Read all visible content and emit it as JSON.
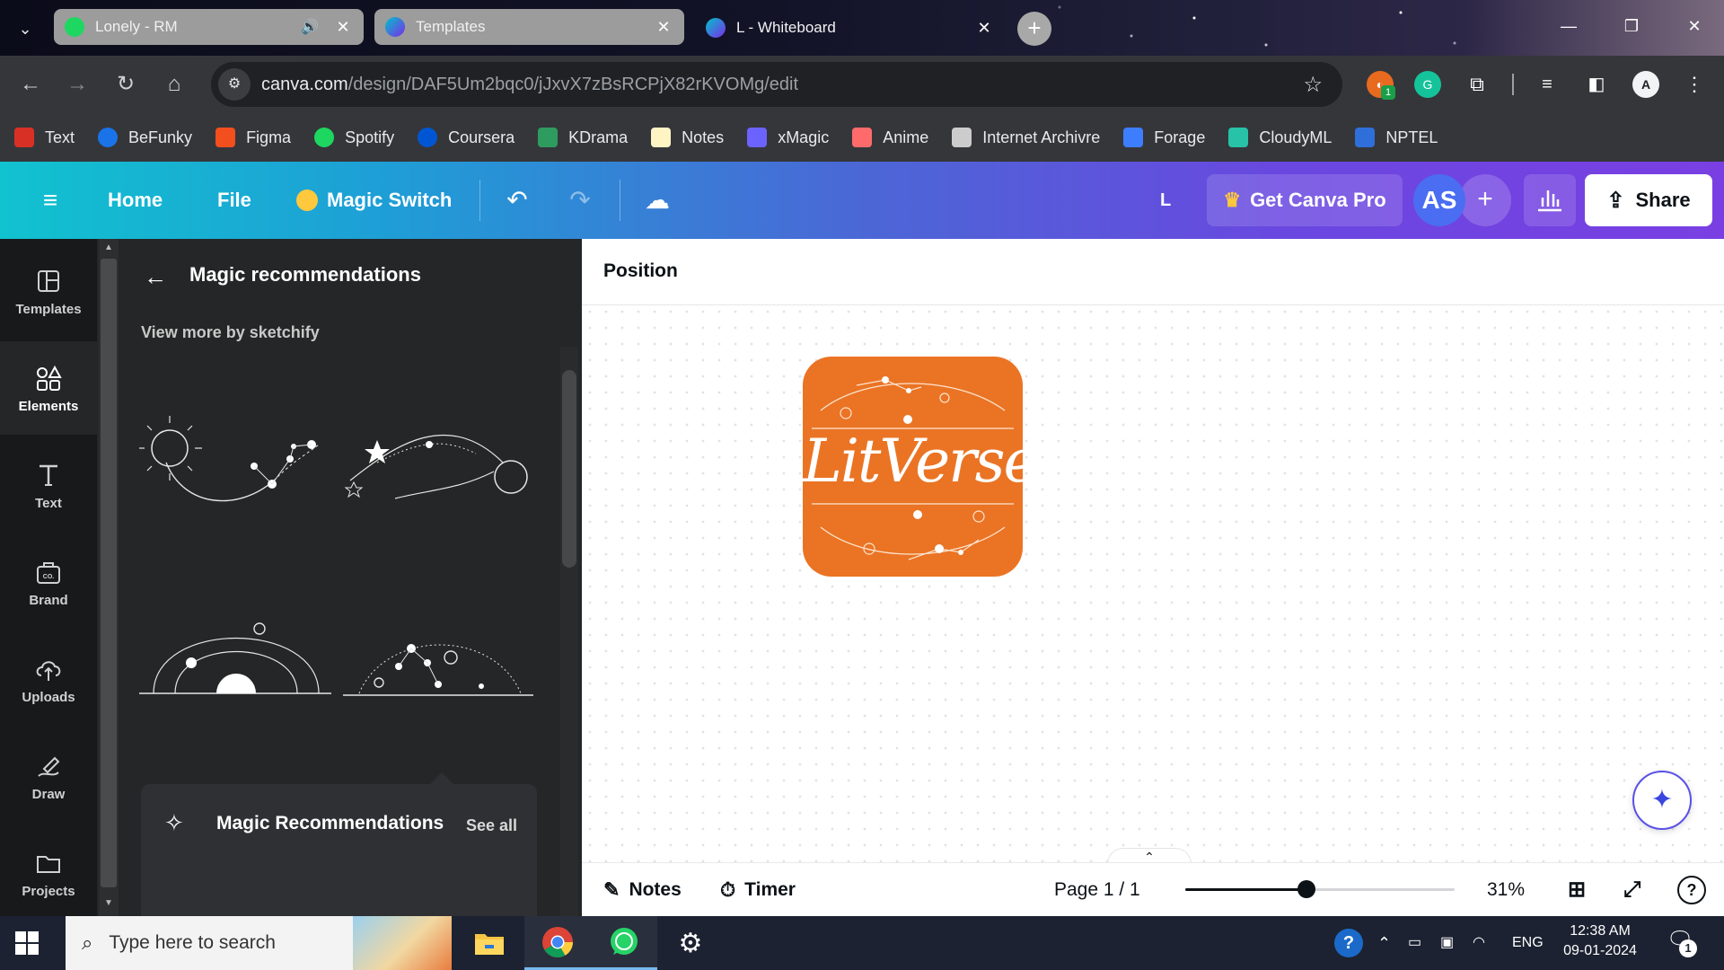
{
  "browser": {
    "tabs": [
      {
        "title": "Lonely - RM",
        "favicon_color": "#1ed760",
        "state": "inactive",
        "audio": true
      },
      {
        "title": "Templates",
        "favicon_color": "#7d2ae8",
        "state": "inactive",
        "audio": false
      },
      {
        "title": "L - Whiteboard",
        "favicon_color": "#00c4cc",
        "state": "active",
        "audio": false
      }
    ],
    "new_tab_label": "+",
    "url_host": "canva.com",
    "url_path": "/design/DAF5Um2bqc0/jJxvX7zBsRCPjX82rKVOMg/edit",
    "extension_badge": "1",
    "profile_initial": "A",
    "bookmarks": [
      {
        "label": "Text",
        "color": "#d93025"
      },
      {
        "label": "BeFunky",
        "color": "#1a73e8"
      },
      {
        "label": "Figma",
        "color": "#f24e1e"
      },
      {
        "label": "Spotify",
        "color": "#1ed760"
      },
      {
        "label": "Coursera",
        "color": "#0056d2"
      },
      {
        "label": "KDrama",
        "color": "#2e9c5f"
      },
      {
        "label": "Notes",
        "color": "#fff4c4"
      },
      {
        "label": "xMagic",
        "color": "#6c63ff"
      },
      {
        "label": "Anime",
        "color": "#ff6b6b"
      },
      {
        "label": "Internet Archivre",
        "color": "#cccccc"
      },
      {
        "label": "Forage",
        "color": "#3d7eff"
      },
      {
        "label": "CloudyML",
        "color": "#27c2a8"
      },
      {
        "label": "NPTEL",
        "color": "#2f6fd9"
      }
    ]
  },
  "canva_header": {
    "home": "Home",
    "file": "File",
    "magic_switch": "Magic Switch",
    "doc_initial": "L",
    "get_pro": "Get Canva Pro",
    "avatar": "AS",
    "add_member": "+",
    "share": "Share"
  },
  "rail": [
    {
      "label": "Templates",
      "icon": "templates-icon",
      "selected": false
    },
    {
      "label": "Elements",
      "icon": "elements-icon",
      "selected": true
    },
    {
      "label": "Text",
      "icon": "text-icon",
      "selected": false
    },
    {
      "label": "Brand",
      "icon": "brand-icon",
      "selected": false
    },
    {
      "label": "Uploads",
      "icon": "uploads-icon",
      "selected": false
    },
    {
      "label": "Draw",
      "icon": "draw-icon",
      "selected": false
    },
    {
      "label": "Projects",
      "icon": "projects-icon",
      "selected": false
    }
  ],
  "panel": {
    "title": "Magic recommendations",
    "view_more": "View more by sketchify",
    "magic_card_title": "Magic Recommendations",
    "see_all": "See all"
  },
  "canvas": {
    "position_label": "Position",
    "logo_text": "LitVerse",
    "logo_color": "#ea7424"
  },
  "footer": {
    "notes": "Notes",
    "timer": "Timer",
    "page": "Page 1 / 1",
    "zoom_label": "31%",
    "zoom_fraction": 0.45
  },
  "taskbar": {
    "search_placeholder": "Type here to search",
    "language": "ENG",
    "time": "12:38 AM",
    "date": "09-01-2024",
    "notification_count": "1"
  }
}
